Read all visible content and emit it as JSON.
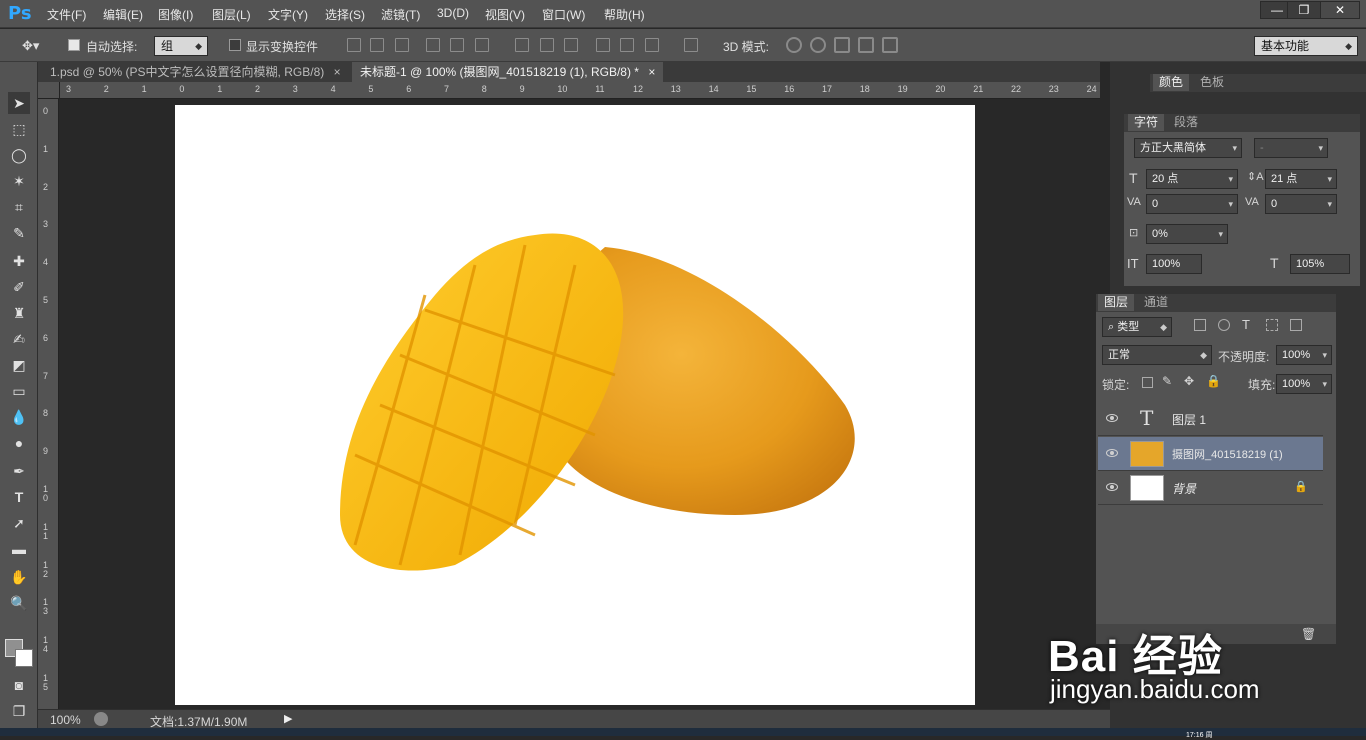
{
  "app": {
    "logo": "Ps"
  },
  "menu": [
    "文件(F)",
    "编辑(E)",
    "图像(I)",
    "图层(L)",
    "文字(Y)",
    "选择(S)",
    "滤镜(T)",
    "3D(D)",
    "视图(V)",
    "窗口(W)",
    "帮助(H)"
  ],
  "window_controls": {
    "minimize": "—",
    "restore": "❐",
    "close": "✕"
  },
  "options": {
    "auto_select_label": "自动选择:",
    "auto_select_value": "组",
    "show_transform_label": "显示变换控件",
    "mode_3d_label": "3D 模式:",
    "workspace": "基本功能"
  },
  "tabs": [
    {
      "label": "1.psd @ 50% (PS中文字怎么设置径向模糊, RGB/8)",
      "close": "×"
    },
    {
      "label": "未标题-1 @ 100% (摄图网_401518219 (1), RGB/8) *",
      "close": "×"
    }
  ],
  "ruler_top": [
    "3",
    "2",
    "1",
    "0",
    "1",
    "2",
    "3",
    "4",
    "5",
    "6",
    "7",
    "8",
    "9",
    "10",
    "11",
    "12",
    "13",
    "14",
    "15",
    "16",
    "17",
    "18",
    "19",
    "20",
    "21",
    "22",
    "23",
    "24"
  ],
  "ruler_left": [
    "0",
    "1",
    "2",
    "3",
    "4",
    "5",
    "6",
    "7",
    "8",
    "9",
    "1\n0",
    "1\n1",
    "1\n2",
    "1\n3",
    "1\n4",
    "1\n5"
  ],
  "status": {
    "zoom": "100%",
    "doc_info": "文档:1.37M/1.90M"
  },
  "color_panel": {
    "tabs": [
      "颜色",
      "色板"
    ]
  },
  "char_panel": {
    "tabs": [
      "字符",
      "段落"
    ],
    "font_family": "方正大黑简体",
    "font_style": "-",
    "font_size": "20 点",
    "leading": "21 点",
    "kerning": "0",
    "tracking": "0",
    "tsume": "0%",
    "vscale": "100%",
    "hscale": "105%"
  },
  "layers_panel": {
    "tabs": [
      "图层",
      "通道"
    ],
    "filter": "类型",
    "blend_mode": "正常",
    "opacity_label": "不透明度:",
    "opacity": "100%",
    "lock_label": "锁定:",
    "fill_label": "填充:",
    "fill": "100%",
    "layers": [
      {
        "name": "图层 1",
        "type": "text",
        "selected": false
      },
      {
        "name": "摄图网_401518219 (1)",
        "type": "smart",
        "selected": true
      },
      {
        "name": "背景",
        "type": "background",
        "selected": false
      }
    ]
  },
  "watermark": {
    "brand": "Bai 经验",
    "url": "jingyan.baidu.com"
  },
  "clock": "17:16 周"
}
